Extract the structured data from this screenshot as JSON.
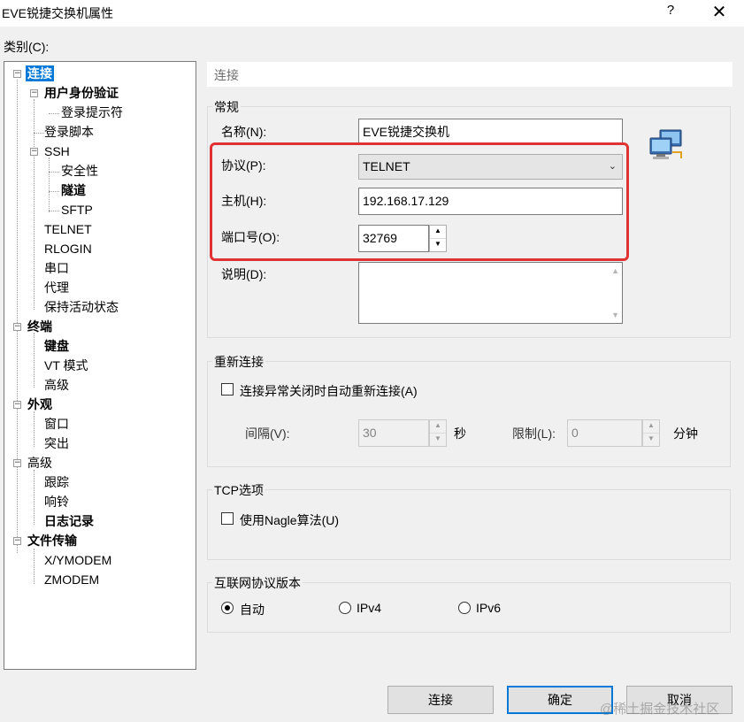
{
  "window": {
    "title": "EVE锐捷交换机属性",
    "help": "?",
    "close": "✕"
  },
  "category_label": "类别(C):",
  "tree": [
    {
      "label": "连接",
      "bold": true,
      "selected": true
    },
    {
      "label": "用户身份验证",
      "bold": true
    },
    {
      "label": "登录提示符"
    },
    {
      "label": "登录脚本"
    },
    {
      "label": "SSH"
    },
    {
      "label": "安全性"
    },
    {
      "label": "隧道",
      "bold": true
    },
    {
      "label": "SFTP"
    },
    {
      "label": "TELNET"
    },
    {
      "label": "RLOGIN"
    },
    {
      "label": "串口"
    },
    {
      "label": "代理"
    },
    {
      "label": "保持活动状态"
    },
    {
      "label": "终端",
      "bold": true
    },
    {
      "label": "键盘",
      "bold": true
    },
    {
      "label": "VT 模式"
    },
    {
      "label": "高级"
    },
    {
      "label": "外观",
      "bold": true
    },
    {
      "label": "窗口"
    },
    {
      "label": "突出"
    },
    {
      "label": "高级"
    },
    {
      "label": "跟踪"
    },
    {
      "label": "响铃"
    },
    {
      "label": "日志记录",
      "bold": true
    },
    {
      "label": "文件传输",
      "bold": true
    },
    {
      "label": "X/YMODEM"
    },
    {
      "label": "ZMODEM"
    }
  ],
  "panel": {
    "section_title": "连接",
    "general": {
      "title": "常规",
      "name_label": "名称(N):",
      "name_value": "EVE锐捷交换机",
      "protocol_label": "协议(P):",
      "protocol_value": "TELNET",
      "host_label": "主机(H):",
      "host_value": "192.168.17.129",
      "port_label": "端口号(O):",
      "port_value": "32769",
      "desc_label": "说明(D):",
      "desc_value": ""
    },
    "reconnect": {
      "title": "重新连接",
      "auto_label": "连接异常关闭时自动重新连接(A)",
      "auto_checked": false,
      "interval_label": "间隔(V):",
      "interval_value": "30",
      "interval_unit": "秒",
      "limit_label": "限制(L):",
      "limit_value": "0",
      "limit_unit": "分钟"
    },
    "tcp": {
      "title": "TCP选项",
      "nagle_label": "使用Nagle算法(U)",
      "nagle_checked": false
    },
    "ip": {
      "title": "互联网协议版本",
      "options": [
        "自动",
        "IPv4",
        "IPv6"
      ],
      "selected": "自动"
    }
  },
  "buttons": {
    "connect": "连接",
    "ok": "确定",
    "cancel": "取消"
  },
  "watermark": "@稀土掘金技术社区",
  "colors": {
    "highlight_border": "#e03232",
    "selection": "#0078d7",
    "dialog_bg": "#f0f0f0"
  }
}
